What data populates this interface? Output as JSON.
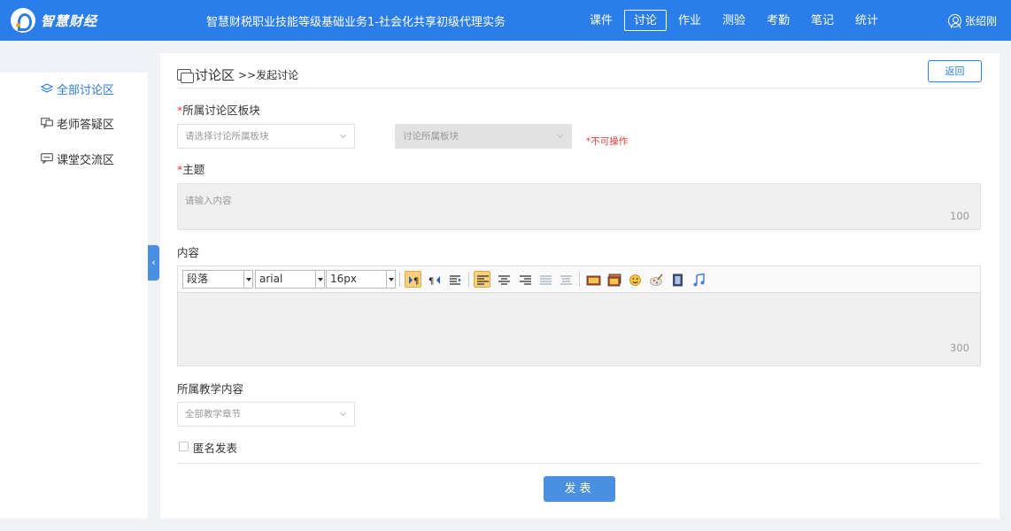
{
  "header": {
    "logo_text": "智慧财经",
    "course_title": "智慧财税职业技能等级基础业务1-社会化共享初级代理实务",
    "nav": [
      "课件",
      "讨论",
      "作业",
      "测验",
      "考勤",
      "笔记",
      "统计"
    ],
    "active_nav": "讨论",
    "user_name": "张绍刚"
  },
  "sidebar": {
    "items": [
      {
        "label": "全部讨论区",
        "icon": "layers-icon",
        "active": true
      },
      {
        "label": "老师答疑区",
        "icon": "chat-bubble-icon",
        "active": false
      },
      {
        "label": "课堂交流区",
        "icon": "message-icon",
        "active": false
      }
    ]
  },
  "page": {
    "title": "讨论区",
    "breadcrumb": ">>发起讨论",
    "back_label": "返回"
  },
  "form": {
    "section_label": "所属讨论区板块",
    "section_placeholder": "请选择讨论所属板块",
    "subsection_placeholder": "讨论所属板块",
    "not_operable": "*不可操作",
    "topic_label": "主题",
    "topic_placeholder": "请输入内容",
    "topic_limit": "100",
    "content_label": "内容",
    "content_limit": "300",
    "teaching_label": "所属教学内容",
    "teaching_placeholder": "全部教学章节",
    "anonymous_label": "匿名发表",
    "submit_label": "发表",
    "required_mark": "*"
  },
  "editor": {
    "paragraph": "段落",
    "font": "arial",
    "size": "16px",
    "buttons": [
      "ltr-icon",
      "rtl-icon",
      "indent-icon",
      "align-left-icon",
      "align-center-icon",
      "align-right-icon",
      "justify-icon",
      "align-justify-center-icon",
      "image-icon",
      "gallery-icon",
      "emoji-icon",
      "scrawl-icon",
      "video-icon",
      "music-icon"
    ]
  },
  "colors": {
    "primary": "#2b7de9",
    "button": "#4a90e2",
    "required": "#e03c3c"
  }
}
